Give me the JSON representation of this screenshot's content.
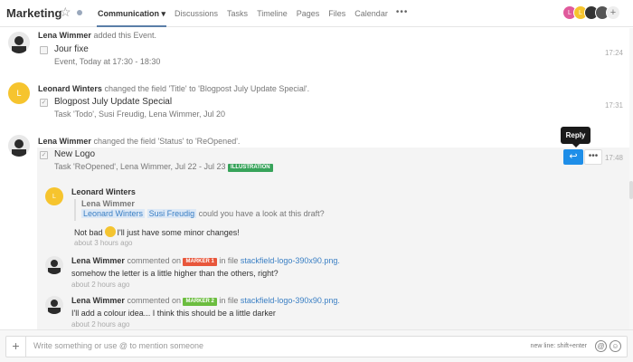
{
  "header": {
    "project": "Marketing",
    "tabs": [
      {
        "label": "Communication ▾"
      },
      {
        "label": "Discussions"
      },
      {
        "label": "Tasks"
      },
      {
        "label": "Timeline"
      },
      {
        "label": "Pages"
      },
      {
        "label": "Files"
      },
      {
        "label": "Calendar"
      }
    ],
    "more": "•••",
    "avatars": [
      {
        "initial": "L",
        "color": "#e05a9c"
      },
      {
        "initial": "L",
        "color": "#f6c42e"
      },
      {
        "initial": "",
        "color": "#333333"
      },
      {
        "initial": "",
        "color": "#555555"
      }
    ],
    "add": "+"
  },
  "feed": {
    "events": [
      {
        "author": "Lena Wimmer",
        "action": " added this Event.",
        "title": "Jour fixe",
        "sub": "Event, Today at 17:30 - 18:30",
        "time": "17:24"
      },
      {
        "initial": "L",
        "author": "Leonard Winters",
        "action": " changed the field 'Title' to 'Blogpost July Update Special'.",
        "title": "Blogpost July Update Special",
        "sub": "Task 'Todo', Susi Freudig, Lena Wimmer, Jul 20",
        "time": "17:31"
      },
      {
        "author": "Lena Wimmer",
        "action": " changed the field 'Status' to 'ReOpened'.",
        "title": "New Logo",
        "sub": "Task 'ReOpened', Lena Wimmer, Jul 22 - Jul 23",
        "tag": "ILLUSTRATION",
        "time": "17:48"
      }
    ],
    "tooltip": "Reply",
    "reply_icon": "↩",
    "more_icon": "•••",
    "comments": [
      {
        "initial": "L",
        "author": "Leonard Winters",
        "quote_author": "Lena Wimmer",
        "mention1": "Leonard Winters",
        "mention2": "Susi Freudig",
        "quote_text": " could you have a look at this draft?",
        "text_before": "Not bad",
        "text_after": "I'll just have some minor changes!",
        "ago": "about 3 hours ago"
      },
      {
        "author": "Lena Wimmer",
        "verb": " commented on ",
        "marker": "MARKER 1",
        "in_file": " in file ",
        "file": "stackfield-logo-390x90.png.",
        "text": "somehow the letter is a little higher than the others, right?",
        "ago": "about 2 hours ago"
      },
      {
        "author": "Lena Wimmer",
        "verb": " commented on ",
        "marker": "MARKER 2",
        "in_file": " in file ",
        "file": "stackfield-logo-390x90.png.",
        "text": "I'll add a colour idea... I think this should be a little darker",
        "ago": "about 2 hours ago"
      }
    ]
  },
  "composer": {
    "plus": "+",
    "placeholder": "Write something or use @ to mention someone",
    "hint": "new line: shift+enter"
  }
}
